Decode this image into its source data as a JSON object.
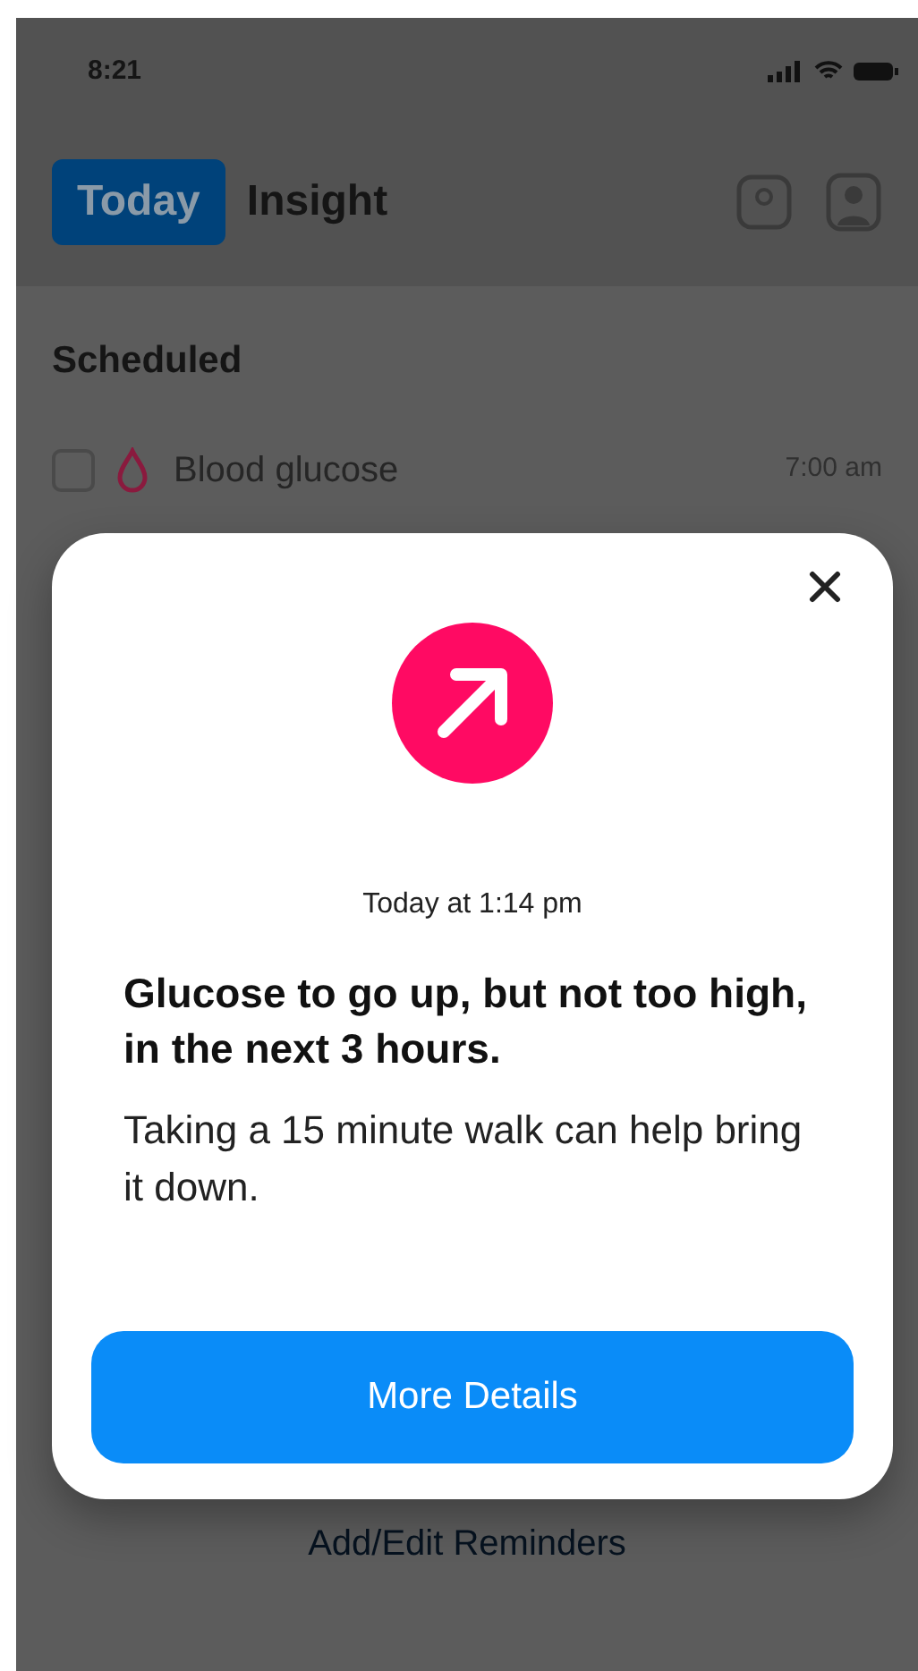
{
  "status_bar": {
    "time": "8:21"
  },
  "tabs": [
    {
      "label": "Today",
      "selected": true
    },
    {
      "label": "Insight",
      "selected": false
    }
  ],
  "section": {
    "title": "Scheduled"
  },
  "tasks": [
    {
      "label": "Blood glucose",
      "time": "7:00 am",
      "checked": false
    }
  ],
  "reminders_link": "Add/Edit Reminders",
  "dialog": {
    "timestamp": "Today at 1:14 pm",
    "headline": "Glucose to go up, but not too high, in the next 3 hours.",
    "body": "Taking a 15 minute walk can help bring it down.",
    "button": "More Details"
  }
}
